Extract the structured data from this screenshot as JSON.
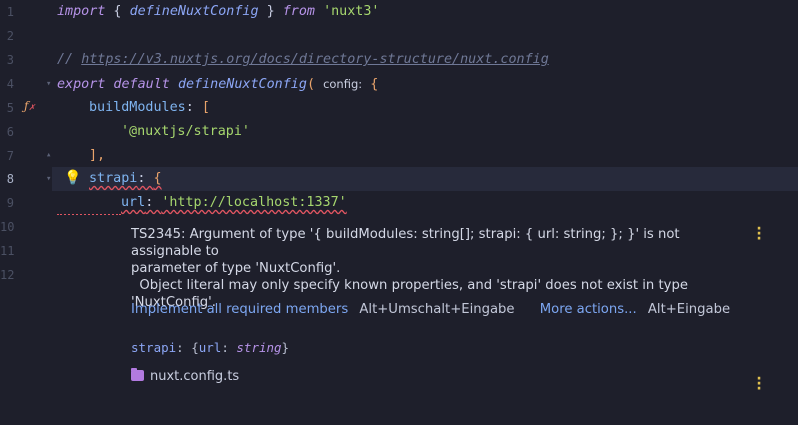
{
  "editor": {
    "line_numbers": [
      "1",
      "2",
      "3",
      "4",
      "5",
      "6",
      "7",
      "8",
      "9",
      "10",
      "11",
      "12"
    ],
    "lines": {
      "l1": {
        "kw1": "import",
        "p1": " { ",
        "fn": "defineNuxtConfig",
        "p2": " } ",
        "kw2": "from",
        "sp": " ",
        "str": "'nuxt3'"
      },
      "l3": {
        "slashes": "// ",
        "url": "https://v3.nuxtjs.org/docs/directory-structure/nuxt.config"
      },
      "l4": {
        "kw1": "export default",
        "sp": " ",
        "fn": "defineNuxtConfig",
        "paren": "(",
        "hint": "config:",
        "brace": "{"
      },
      "l5": {
        "prop": "buildModules",
        "colon": ": ",
        "bracket": "["
      },
      "l6": {
        "str": "'@nuxtjs/strapi'"
      },
      "l7": {
        "bracket": "],"
      },
      "l8": {
        "prop": "strapi",
        "colon": ": ",
        "brace": "{"
      },
      "l9": {
        "prop": "url",
        "colon": ": ",
        "str": "'http://localhost:1337'"
      },
      "l10": {
        "brace": "}"
      },
      "l11": {
        "close": "})"
      }
    }
  },
  "tooltip": {
    "error_line1": "TS2345: Argument of type '{ buildModules: string[]; strapi: { url: string; }; }' is not assignable to",
    "error_line2": "parameter of type 'NuxtConfig'.",
    "error_line3": "  Object literal may only specify known properties, and 'strapi' does not exist in type",
    "error_line4": "'NuxtConfig'.",
    "action1_label": "Implement all required members",
    "action1_shortcut": "Alt+Umschalt+Eingabe",
    "action2_label": "More actions...",
    "action2_shortcut": "Alt+Eingabe",
    "signature": {
      "name": "strapi",
      "colon": ": ",
      "open": "{",
      "key": "url",
      "sep": ": ",
      "type": "string",
      "close": "}"
    },
    "file_name": "nuxt.config.ts"
  },
  "colors": {
    "accent": "#7da7f2",
    "error": "#e05561",
    "warning": "#e0c04f",
    "background": "#1e1f2b"
  }
}
